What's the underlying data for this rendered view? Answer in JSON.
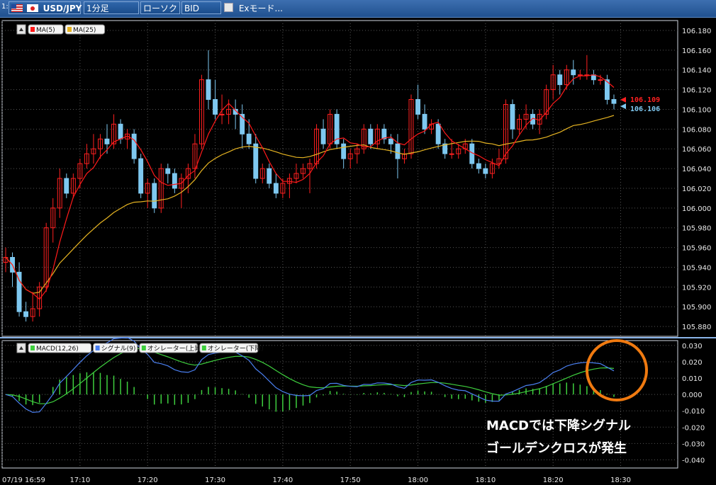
{
  "toolbar": {
    "index": "1:",
    "symbol": "USD/JPY",
    "timeframe": "1分足",
    "chart_type": "ローソク",
    "price_type": "BID",
    "ex_mode": "Exモード..."
  },
  "annotation": {
    "line1": "MACDでは下降シグナル",
    "line2": "ゴールデンクロスが発生"
  },
  "colors": {
    "up_candle": "#ff2020",
    "down_candle": "#7ec8f0",
    "ma5": "#ff1a1a",
    "ma25": "#e6b422",
    "macd": "#4a7ff0",
    "signal": "#3ecf3e",
    "osc_up": "#3ecf3e",
    "osc_down": "#3ecf3e",
    "highlight_circle": "#f07a10"
  },
  "chart_data": [
    {
      "type": "candlestick",
      "title": "USD/JPY 1分足",
      "legend": [
        "MA(5)",
        "MA(25)"
      ],
      "ylim": [
        105.87,
        106.19
      ],
      "yticks": [
        "106.180",
        "106.160",
        "106.140",
        "106.120",
        "106.100",
        "106.080",
        "106.060",
        "106.040",
        "106.020",
        "106.000",
        "105.980",
        "105.960",
        "105.940",
        "105.920",
        "105.900",
        "105.880"
      ],
      "xticks": [
        "07/19 16:59",
        "17:10",
        "17:20",
        "17:30",
        "17:40",
        "17:50",
        "18:00",
        "18:10",
        "18:20",
        "18:30"
      ],
      "price_labels": {
        "ask": "106.109",
        "bid": "106.106"
      },
      "candles": [
        {
          "o": 105.945,
          "h": 105.96,
          "l": 105.935,
          "c": 105.95
        },
        {
          "o": 105.95,
          "h": 105.955,
          "l": 105.92,
          "c": 105.935
        },
        {
          "o": 105.935,
          "h": 105.945,
          "l": 105.89,
          "c": 105.895
        },
        {
          "o": 105.895,
          "h": 105.905,
          "l": 105.885,
          "c": 105.89
        },
        {
          "o": 105.89,
          "h": 105.915,
          "l": 105.885,
          "c": 105.898
        },
        {
          "o": 105.898,
          "h": 105.925,
          "l": 105.89,
          "c": 105.92
        },
        {
          "o": 105.92,
          "h": 105.985,
          "l": 105.915,
          "c": 105.98
        },
        {
          "o": 105.98,
          "h": 106.01,
          "l": 105.965,
          "c": 106.0
        },
        {
          "o": 106.0,
          "h": 106.04,
          "l": 105.99,
          "c": 106.03
        },
        {
          "o": 106.03,
          "h": 106.035,
          "l": 106.01,
          "c": 106.015
        },
        {
          "o": 106.015,
          "h": 106.035,
          "l": 106.01,
          "c": 106.03
        },
        {
          "o": 106.03,
          "h": 106.05,
          "l": 106.02,
          "c": 106.045
        },
        {
          "o": 106.045,
          "h": 106.065,
          "l": 106.04,
          "c": 106.055
        },
        {
          "o": 106.055,
          "h": 106.075,
          "l": 106.045,
          "c": 106.06
        },
        {
          "o": 106.06,
          "h": 106.075,
          "l": 106.05,
          "c": 106.07
        },
        {
          "o": 106.07,
          "h": 106.085,
          "l": 106.055,
          "c": 106.065
        },
        {
          "o": 106.065,
          "h": 106.095,
          "l": 106.06,
          "c": 106.085
        },
        {
          "o": 106.085,
          "h": 106.09,
          "l": 106.065,
          "c": 106.07
        },
        {
          "o": 106.07,
          "h": 106.08,
          "l": 106.06,
          "c": 106.075
        },
        {
          "o": 106.075,
          "h": 106.08,
          "l": 106.045,
          "c": 106.05
        },
        {
          "o": 106.05,
          "h": 106.055,
          "l": 106.01,
          "c": 106.015
        },
        {
          "o": 106.015,
          "h": 106.03,
          "l": 106.0,
          "c": 106.025
        },
        {
          "o": 106.025,
          "h": 106.03,
          "l": 105.995,
          "c": 106.0
        },
        {
          "o": 106.0,
          "h": 106.045,
          "l": 105.995,
          "c": 106.04
        },
        {
          "o": 106.04,
          "h": 106.045,
          "l": 106.025,
          "c": 106.035
        },
        {
          "o": 106.035,
          "h": 106.04,
          "l": 106.015,
          "c": 106.02
        },
        {
          "o": 106.02,
          "h": 106.035,
          "l": 106.0,
          "c": 106.03
        },
        {
          "o": 106.03,
          "h": 106.045,
          "l": 106.015,
          "c": 106.04
        },
        {
          "o": 106.04,
          "h": 106.075,
          "l": 106.03,
          "c": 106.065
        },
        {
          "o": 106.065,
          "h": 106.135,
          "l": 106.06,
          "c": 106.13
        },
        {
          "o": 106.13,
          "h": 106.16,
          "l": 106.1,
          "c": 106.11
        },
        {
          "o": 106.11,
          "h": 106.13,
          "l": 106.09,
          "c": 106.095
        },
        {
          "o": 106.095,
          "h": 106.115,
          "l": 106.085,
          "c": 106.095
        },
        {
          "o": 106.095,
          "h": 106.11,
          "l": 106.085,
          "c": 106.1
        },
        {
          "o": 106.1,
          "h": 106.11,
          "l": 106.08,
          "c": 106.095
        },
        {
          "o": 106.095,
          "h": 106.105,
          "l": 106.06,
          "c": 106.075
        },
        {
          "o": 106.075,
          "h": 106.09,
          "l": 106.06,
          "c": 106.065
        },
        {
          "o": 106.065,
          "h": 106.075,
          "l": 106.025,
          "c": 106.03
        },
        {
          "o": 106.03,
          "h": 106.045,
          "l": 106.025,
          "c": 106.04
        },
        {
          "o": 106.04,
          "h": 106.045,
          "l": 106.02,
          "c": 106.025
        },
        {
          "o": 106.025,
          "h": 106.035,
          "l": 106.01,
          "c": 106.015
        },
        {
          "o": 106.015,
          "h": 106.03,
          "l": 106.01,
          "c": 106.025
        },
        {
          "o": 106.025,
          "h": 106.035,
          "l": 106.01,
          "c": 106.03
        },
        {
          "o": 106.03,
          "h": 106.045,
          "l": 106.025,
          "c": 106.035
        },
        {
          "o": 106.035,
          "h": 106.045,
          "l": 106.03,
          "c": 106.04
        },
        {
          "o": 106.04,
          "h": 106.05,
          "l": 106.015,
          "c": 106.045
        },
        {
          "o": 106.045,
          "h": 106.085,
          "l": 106.04,
          "c": 106.08
        },
        {
          "o": 106.08,
          "h": 106.09,
          "l": 106.06,
          "c": 106.065
        },
        {
          "o": 106.065,
          "h": 106.1,
          "l": 106.06,
          "c": 106.095
        },
        {
          "o": 106.095,
          "h": 106.1,
          "l": 106.06,
          "c": 106.065
        },
        {
          "o": 106.065,
          "h": 106.07,
          "l": 106.04,
          "c": 106.05
        },
        {
          "o": 106.05,
          "h": 106.06,
          "l": 106.04,
          "c": 106.055
        },
        {
          "o": 106.055,
          "h": 106.065,
          "l": 106.045,
          "c": 106.06
        },
        {
          "o": 106.06,
          "h": 106.085,
          "l": 106.055,
          "c": 106.08
        },
        {
          "o": 106.08,
          "h": 106.085,
          "l": 106.06,
          "c": 106.065
        },
        {
          "o": 106.065,
          "h": 106.085,
          "l": 106.06,
          "c": 106.08
        },
        {
          "o": 106.08,
          "h": 106.085,
          "l": 106.065,
          "c": 106.07
        },
        {
          "o": 106.07,
          "h": 106.075,
          "l": 106.055,
          "c": 106.065
        },
        {
          "o": 106.065,
          "h": 106.075,
          "l": 106.03,
          "c": 106.05
        },
        {
          "o": 106.05,
          "h": 106.06,
          "l": 106.045,
          "c": 106.055
        },
        {
          "o": 106.055,
          "h": 106.115,
          "l": 106.05,
          "c": 106.11
        },
        {
          "o": 106.11,
          "h": 106.125,
          "l": 106.09,
          "c": 106.095
        },
        {
          "o": 106.095,
          "h": 106.105,
          "l": 106.075,
          "c": 106.08
        },
        {
          "o": 106.08,
          "h": 106.09,
          "l": 106.075,
          "c": 106.085
        },
        {
          "o": 106.085,
          "h": 106.09,
          "l": 106.06,
          "c": 106.065
        },
        {
          "o": 106.065,
          "h": 106.07,
          "l": 106.05,
          "c": 106.055
        },
        {
          "o": 106.055,
          "h": 106.07,
          "l": 106.05,
          "c": 106.055
        },
        {
          "o": 106.055,
          "h": 106.065,
          "l": 106.05,
          "c": 106.06
        },
        {
          "o": 106.06,
          "h": 106.07,
          "l": 106.055,
          "c": 106.065
        },
        {
          "o": 106.065,
          "h": 106.07,
          "l": 106.04,
          "c": 106.045
        },
        {
          "o": 106.045,
          "h": 106.05,
          "l": 106.035,
          "c": 106.04
        },
        {
          "o": 106.04,
          "h": 106.045,
          "l": 106.03,
          "c": 106.035
        },
        {
          "o": 106.035,
          "h": 106.05,
          "l": 106.03,
          "c": 106.045
        },
        {
          "o": 106.045,
          "h": 106.06,
          "l": 106.04,
          "c": 106.05
        },
        {
          "o": 106.05,
          "h": 106.11,
          "l": 106.045,
          "c": 106.105
        },
        {
          "o": 106.105,
          "h": 106.11,
          "l": 106.07,
          "c": 106.08
        },
        {
          "o": 106.08,
          "h": 106.095,
          "l": 106.075,
          "c": 106.09
        },
        {
          "o": 106.09,
          "h": 106.105,
          "l": 106.08,
          "c": 106.095
        },
        {
          "o": 106.095,
          "h": 106.1,
          "l": 106.08,
          "c": 106.085
        },
        {
          "o": 106.085,
          "h": 106.1,
          "l": 106.075,
          "c": 106.095
        },
        {
          "o": 106.095,
          "h": 106.125,
          "l": 106.09,
          "c": 106.12
        },
        {
          "o": 106.12,
          "h": 106.145,
          "l": 106.11,
          "c": 106.135
        },
        {
          "o": 106.135,
          "h": 106.14,
          "l": 106.115,
          "c": 106.125
        },
        {
          "o": 106.125,
          "h": 106.145,
          "l": 106.12,
          "c": 106.14
        },
        {
          "o": 106.14,
          "h": 106.15,
          "l": 106.125,
          "c": 106.135
        },
        {
          "o": 106.135,
          "h": 106.14,
          "l": 106.13,
          "c": 106.135
        },
        {
          "o": 106.135,
          "h": 106.155,
          "l": 106.13,
          "c": 106.135
        },
        {
          "o": 106.135,
          "h": 106.14,
          "l": 106.125,
          "c": 106.13
        },
        {
          "o": 106.13,
          "h": 106.135,
          "l": 106.125,
          "c": 106.13
        },
        {
          "o": 106.13,
          "h": 106.135,
          "l": 106.105,
          "c": 106.11
        },
        {
          "o": 106.11,
          "h": 106.115,
          "l": 106.1,
          "c": 106.106
        }
      ]
    },
    {
      "type": "line",
      "title": "MACD",
      "legend": [
        "MACD(12,26)",
        "シグナル(9)",
        "オシレーター(上昇)",
        "オシレーター(下降)"
      ],
      "ylim": [
        -0.045,
        0.033
      ],
      "yticks": [
        "0.030",
        "0.020",
        "0.010",
        "0.000",
        "-0.010",
        "-0.020",
        "-0.030",
        "-0.040"
      ]
    }
  ]
}
